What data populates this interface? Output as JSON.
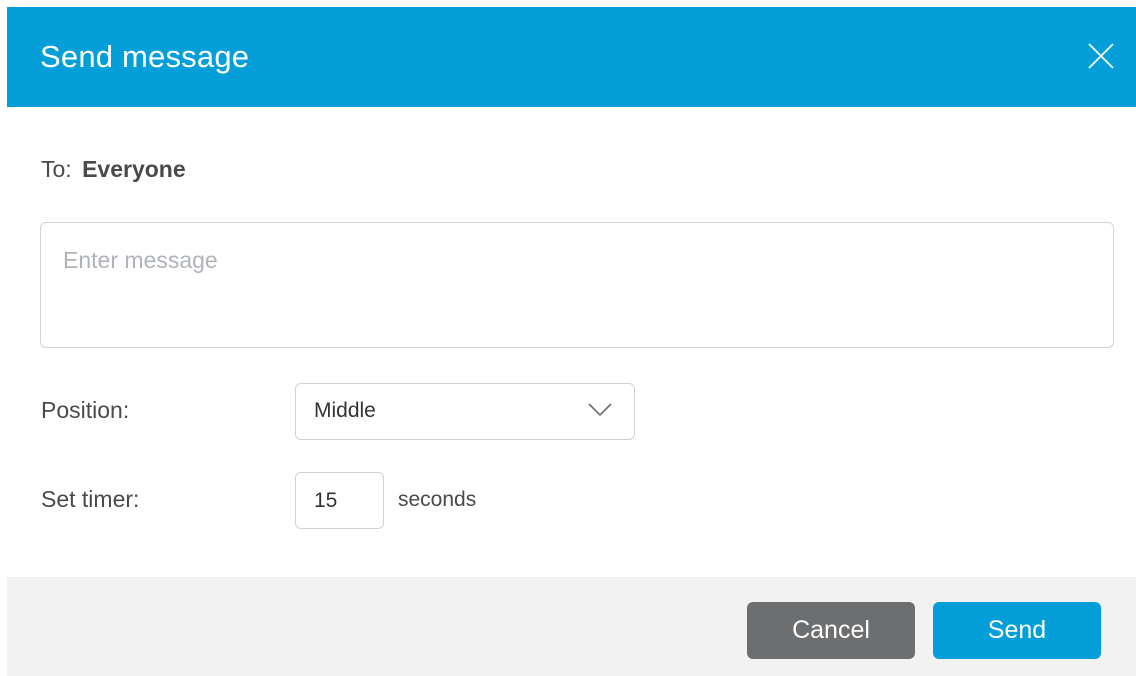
{
  "dialog": {
    "title": "Send message",
    "close_icon": "close-icon"
  },
  "recipient": {
    "label": "To:",
    "value": "Everyone"
  },
  "message": {
    "value": "",
    "placeholder": "Enter message"
  },
  "position": {
    "label": "Position:",
    "selected": "Middle",
    "icon": "chevron-down-icon"
  },
  "timer": {
    "label": "Set timer:",
    "value": "15",
    "unit": "seconds"
  },
  "actions": {
    "cancel_label": "Cancel",
    "send_label": "Send"
  },
  "colors": {
    "header": "#049fd9",
    "send_button": "#049fd9",
    "cancel_button": "#6c6e70",
    "footer": "#f2f2f3"
  }
}
